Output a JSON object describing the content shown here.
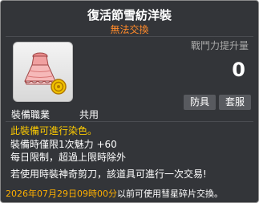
{
  "item": {
    "name": "復活節雪紡洋裝",
    "trade_status": "無法交換",
    "power_label": "戰鬥力提升量",
    "power_value": "0",
    "tags": [
      "防具",
      "套服"
    ],
    "job_label": "裝備職業",
    "job_value": "共用",
    "dye_note": "此裝備可進行染色。",
    "charm_note": "裝備時僅限1次魅力 +60",
    "daily_limit_note": "每日限制，超過上限時除外",
    "scissors_note": "若使用時裝神奇剪刀，該道具可進行一次交易!",
    "expire_date": "2026年07月29日09時00分",
    "expire_suffix": "以前可使用彗星碎片交換。"
  },
  "colors": {
    "background": "#333539",
    "title": "#ffffff",
    "trade_status": "#ff8a2a",
    "dye_note": "#ffcc00",
    "expire_date": "#ffb000"
  },
  "icons": {
    "item_icon": "pink-dress-with-coin-icon"
  }
}
